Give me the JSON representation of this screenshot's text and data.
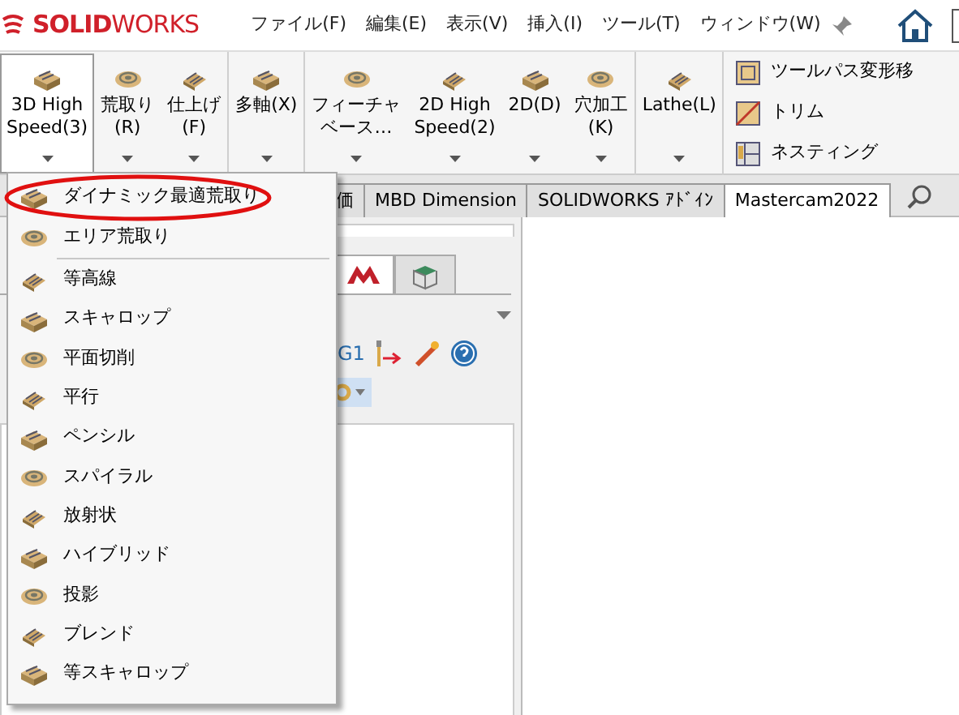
{
  "menu_bar": {
    "logo": "**SOLID**WORKS",
    "items": [
      "ファイル(F)",
      "編集(E)",
      "表示(V)",
      "挿入(I)",
      "ツール(T)",
      "ウィンドウ(W)"
    ]
  },
  "ribbon": {
    "groups": [
      {
        "buttons": [
          {
            "lines": [
              "3D High",
              "Speed(3)"
            ],
            "selected": true
          },
          {
            "lines": [
              "荒取り",
              "(R)"
            ],
            "selected": false
          },
          {
            "lines": [
              "仕上げ",
              "(F)"
            ],
            "selected": false
          }
        ]
      },
      {
        "buttons": [
          {
            "lines": [
              "多軸(X)"
            ],
            "selected": false
          }
        ]
      },
      {
        "buttons": [
          {
            "lines": [
              "フィーチャ",
              "ベース…"
            ],
            "selected": false
          },
          {
            "lines": [
              "2D High",
              "Speed(2)"
            ],
            "selected": false
          },
          {
            "lines": [
              "2D(D)"
            ],
            "selected": false
          },
          {
            "lines": [
              "穴加工",
              "(K)"
            ],
            "selected": false
          }
        ]
      },
      {
        "buttons": [
          {
            "lines": [
              "Lathe(L)"
            ],
            "selected": false
          }
        ]
      }
    ],
    "side_buttons": [
      "ツールパス変形移",
      "トリム",
      "ネスティング"
    ]
  },
  "tabs": [
    {
      "label": "価",
      "selected": false
    },
    {
      "label": "MBD Dimension",
      "selected": false
    },
    {
      "label": "SOLIDWORKS ｱﾄﾞｲﾝ",
      "selected": false
    },
    {
      "label": "Mastercam2022",
      "selected": true
    }
  ],
  "panel": {
    "toolbar_text": "G1"
  },
  "dropdown": {
    "items": [
      {
        "label": "ダイナミック最適荒取り",
        "circled": true,
        "divider_after": false
      },
      {
        "label": "エリア荒取り",
        "circled": false,
        "divider_after": true
      },
      {
        "label": "等高線",
        "circled": false,
        "divider_after": false
      },
      {
        "label": "スキャロップ",
        "circled": false,
        "divider_after": false
      },
      {
        "label": "平面切削",
        "circled": false,
        "divider_after": false
      },
      {
        "label": "平行",
        "circled": false,
        "divider_after": false
      },
      {
        "label": "ペンシル",
        "circled": false,
        "divider_after": false
      },
      {
        "label": "スパイラル",
        "circled": false,
        "divider_after": false
      },
      {
        "label": "放射状",
        "circled": false,
        "divider_after": false
      },
      {
        "label": "ハイブリッド",
        "circled": false,
        "divider_after": false
      },
      {
        "label": "投影",
        "circled": false,
        "divider_after": false
      },
      {
        "label": "ブレンド",
        "circled": false,
        "divider_after": false
      },
      {
        "label": "等スキャロップ",
        "circled": false,
        "divider_after": false
      }
    ]
  }
}
